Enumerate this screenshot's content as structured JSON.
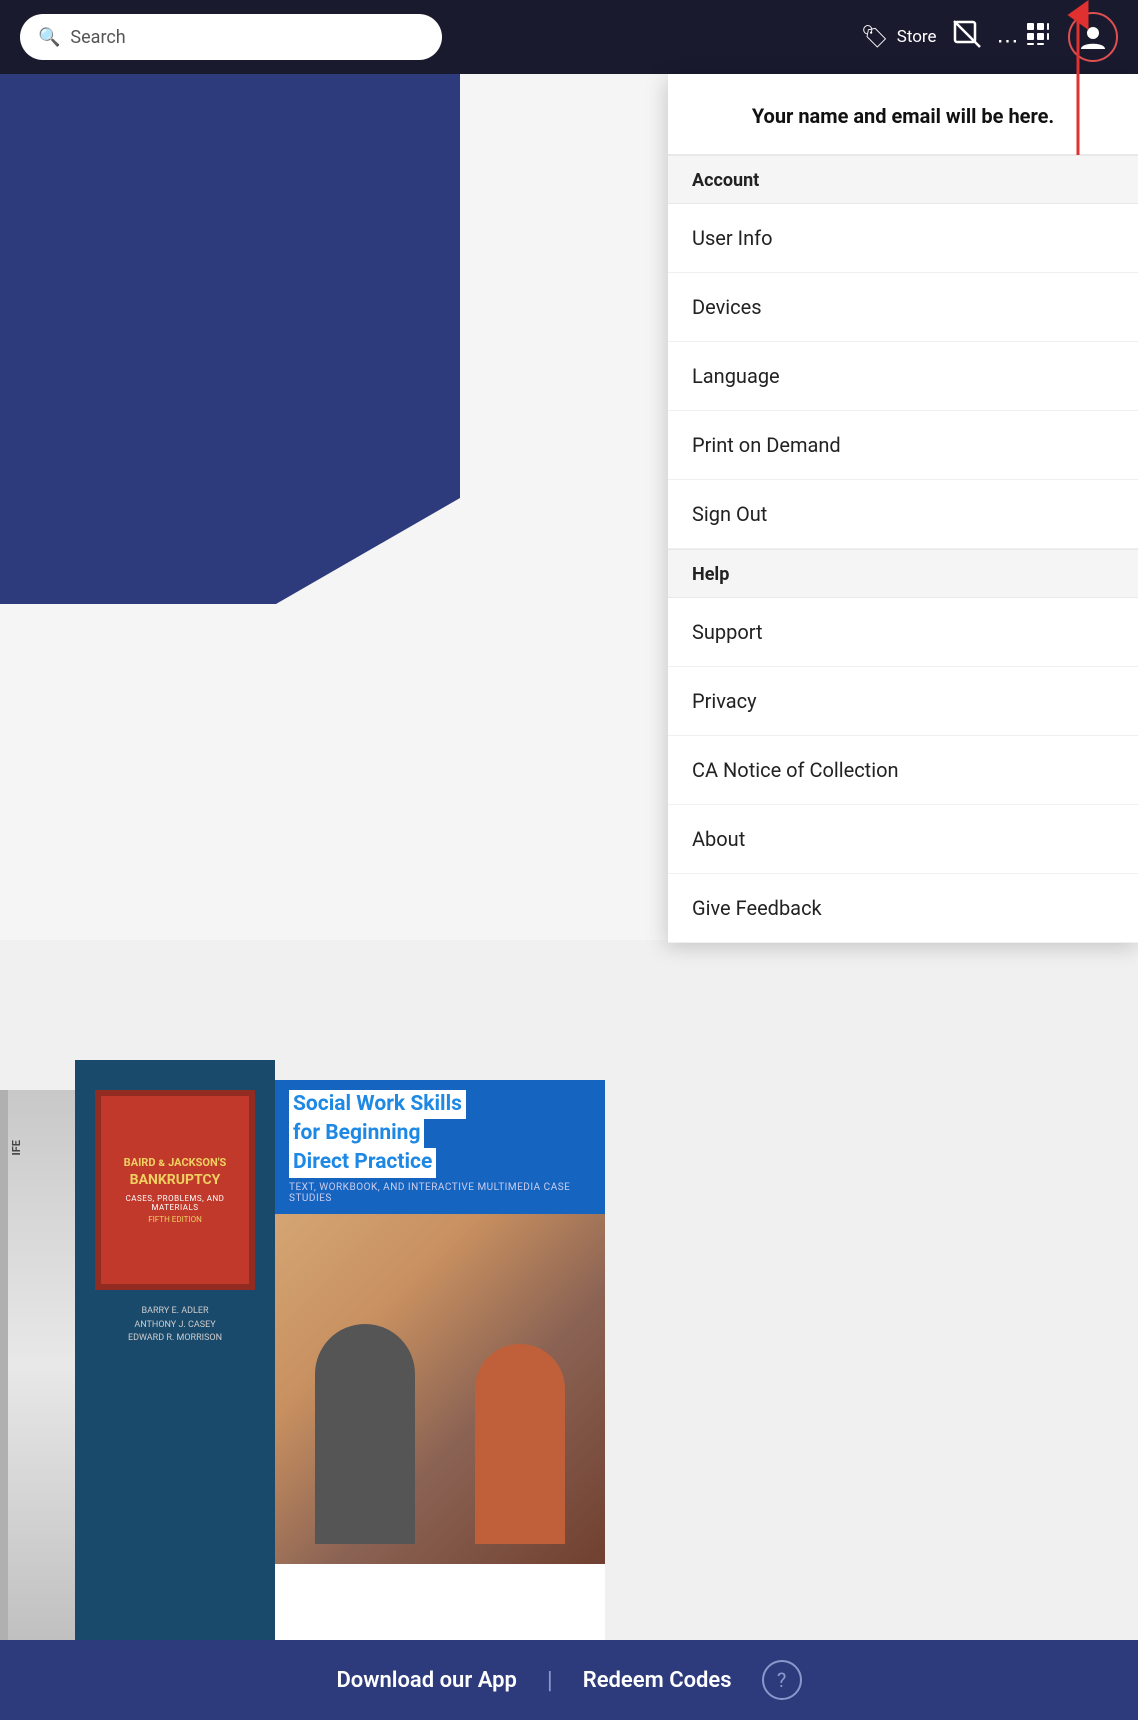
{
  "navbar": {
    "search_placeholder": "Search",
    "store_label": "Store",
    "profile_icon": "person-circle"
  },
  "dropdown": {
    "header_text": "Your name and email will be here.",
    "sections": [
      {
        "label": "Account",
        "items": [
          {
            "id": "user-info",
            "label": "User Info"
          },
          {
            "id": "devices",
            "label": "Devices"
          },
          {
            "id": "language",
            "label": "Language"
          },
          {
            "id": "print-on-demand",
            "label": "Print on Demand"
          },
          {
            "id": "sign-out",
            "label": "Sign Out"
          }
        ]
      },
      {
        "label": "Help",
        "items": [
          {
            "id": "support",
            "label": "Support"
          },
          {
            "id": "privacy",
            "label": "Privacy"
          },
          {
            "id": "ca-notice",
            "label": "CA Notice of Collection"
          },
          {
            "id": "about",
            "label": "About"
          },
          {
            "id": "give-feedback",
            "label": "Give Feedback"
          }
        ]
      }
    ]
  },
  "bottom_bar": {
    "download_label": "Download our App",
    "separator": "|",
    "redeem_label": "Redeem Codes",
    "help_icon": "?"
  },
  "books": {
    "book2": {
      "top_label": "BAIRD & JACKSON'S",
      "title": "BANKRUPTCY",
      "subtitle": "CASES, PROBLEMS, AND\nMATERIALS",
      "edition": "FIFTH EDITION",
      "author1": "BARRY E. ADLER",
      "author2": "ANTHONY J. CASEY",
      "author3": "EDWARD R. MORRISON"
    },
    "book3": {
      "title": "Social Work Skills",
      "title2": "for Beginning",
      "title3": "Direct Practice",
      "subtitle": "TEXT, WORKBOOK, AND INTERACTIVE MULTIMEDIA CASE STUDIES"
    }
  }
}
